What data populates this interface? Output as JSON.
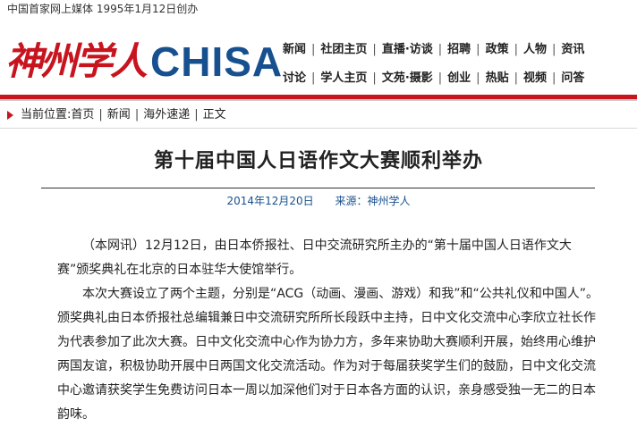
{
  "topline": "中国首家网上媒体 1995年1月12日创办",
  "logo": {
    "chinese": "神州学人",
    "english": "CHISA"
  },
  "nav": {
    "row1": [
      "新闻",
      "社团主页",
      "直播·访谈",
      "招聘",
      "政策",
      "人物",
      "资讯"
    ],
    "row2": [
      "讨论",
      "学人主页",
      "文苑·摄影",
      "创业",
      "热贴",
      "视频",
      "问答"
    ]
  },
  "breadcrumb": {
    "label": "当前位置:",
    "items": [
      "首页",
      "新闻",
      "海外速递",
      "正文"
    ],
    "separator": "|"
  },
  "article": {
    "title": "第十届中国人日语作文大赛顺利举办",
    "date": "2014年12月20日",
    "source": "来源：神州学人",
    "paragraphs": [
      "（本网讯）12月12日，由日本侨报社、日中交流研究所主办的“第十届中国人日语作文大赛”颁奖典礼在北京的日本驻华大使馆举行。",
      "本次大赛设立了两个主题，分别是“ACG（动画、漫画、游戏）和我”和“公共礼仪和中国人”。颁奖典礼由日本侨报社总编辑兼日中交流研究所所长段跃中主持，日中文化交流中心李欣立社长作为代表参加了此次大赛。日中文化交流中心作为协力方，多年来协助大赛顺利开展，始终用心维护两国友谊，积极协助开展中日两国文化交流活动。作为对于每届获奖学生们的鼓励，日中文化交流中心邀请获奖学生免费访问日本一周以加深他们对于日本各方面的认识，亲身感受独一无二的日本韵味。"
    ]
  },
  "colors": {
    "brand_red": "#c8141e",
    "brand_blue": "#17508f"
  }
}
